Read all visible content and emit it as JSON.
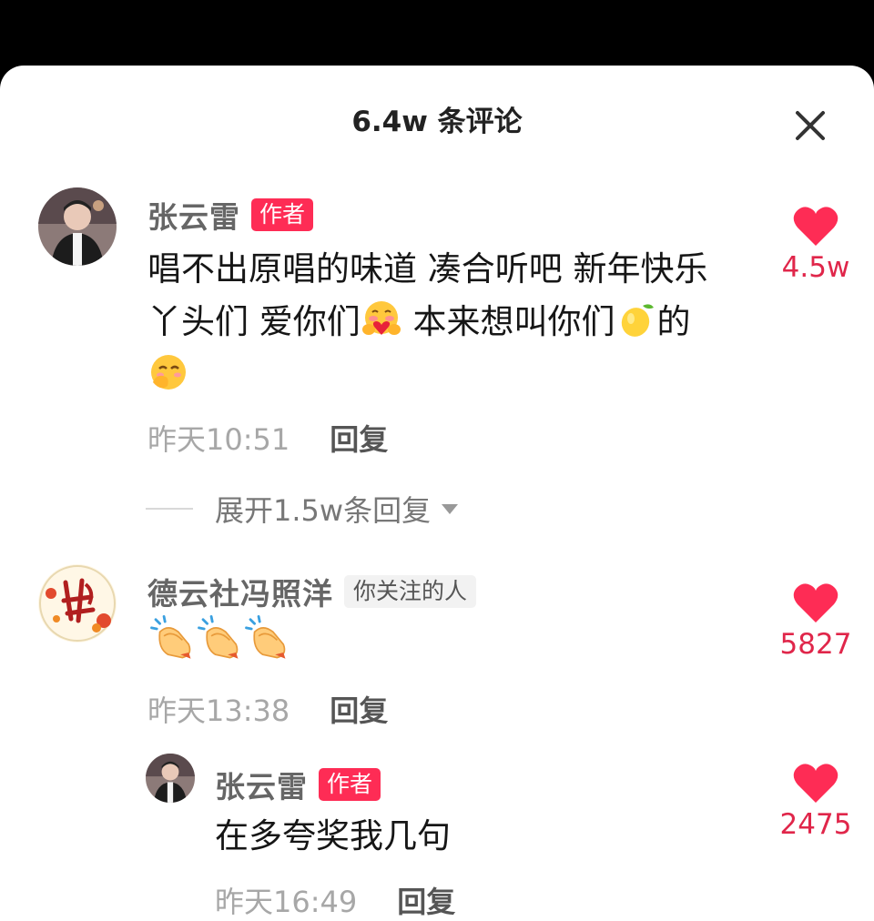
{
  "header": {
    "title": "6.4w 条评论",
    "close_icon": "close-icon"
  },
  "colors": {
    "accent": "#fe2c55",
    "like": "#fe2c55",
    "muted": "#a7a7a7"
  },
  "comments": [
    {
      "author": "张云雷",
      "badge": "作者",
      "text_part1": "唱不出原唱的味道 凑合听吧 新年快乐",
      "text_part2": "丫头们 爱你们",
      "text_part3": " 本来想叫你们",
      "text_part4": "的",
      "emojis": [
        "hug-emoji",
        "lemon-emoji",
        "smirk-emoji"
      ],
      "time": "昨天10:51",
      "reply_label": "回复",
      "likes": "4.5w",
      "expand_label": "展开1.5w条回复"
    },
    {
      "author": "德云社冯照洋",
      "badge": "你关注的人",
      "emojis": [
        "clap-emoji",
        "clap-emoji",
        "clap-emoji"
      ],
      "time": "昨天13:38",
      "reply_label": "回复",
      "likes": "5827"
    },
    {
      "author": "张云雷",
      "badge": "作者",
      "text": "在多夸奖我几句",
      "time": "昨天16:49",
      "reply_label": "回复",
      "likes": "2475"
    }
  ]
}
